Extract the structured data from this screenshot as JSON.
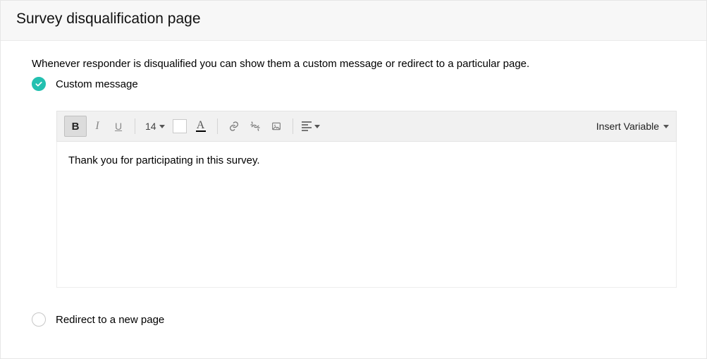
{
  "header": {
    "title": "Survey disqualification page"
  },
  "intro": "Whenever responder is disqualified you can show them a custom message or redirect to a particular page.",
  "options": {
    "custom_message": {
      "label": "Custom message",
      "selected": true
    },
    "redirect": {
      "label": "Redirect to a new page",
      "selected": false
    }
  },
  "toolbar": {
    "font_size": "14",
    "insert_variable_label": "Insert Variable"
  },
  "editor": {
    "content": "Thank you for participating in this survey."
  }
}
